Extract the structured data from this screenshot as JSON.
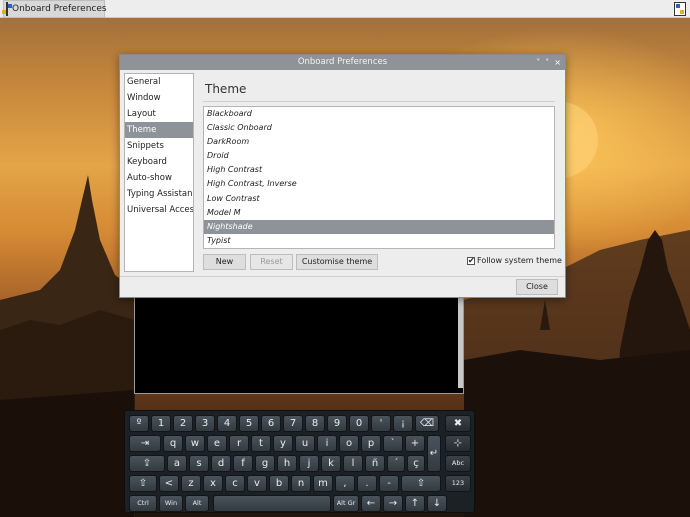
{
  "taskbar": {
    "app_label": "Onboard Preferences",
    "app_icon": "onboard-app-icon",
    "tray_icon": "onboard-tray-icon"
  },
  "dialog": {
    "title": "Onboard Preferences",
    "controls": [
      "˅",
      "˄",
      "×"
    ],
    "sidebar": {
      "items": [
        "General",
        "Window",
        "Layout",
        "Theme",
        "Snippets",
        "Keyboard",
        "Auto-show",
        "Typing Assistance",
        "Universal Access"
      ],
      "selected": "Theme"
    },
    "section_title": "Theme",
    "themes": [
      "Blackboard",
      "Classic Onboard",
      "DarkRoom",
      "Droid",
      "High Contrast",
      "High Contrast, Inverse",
      "Low Contrast",
      "Model M",
      "Nightshade",
      "Typist"
    ],
    "selected_theme": "Nightshade",
    "buttons": {
      "new": "New",
      "reset": "Reset",
      "customise": "Customise theme",
      "close": "Close"
    },
    "follow_system_theme": {
      "label": "Follow system theme",
      "checked": true,
      "mark": "✔"
    }
  },
  "keyboard": {
    "row1": [
      "º",
      "1",
      "2",
      "3",
      "4",
      "5",
      "6",
      "7",
      "8",
      "9",
      "0",
      "'",
      "¡",
      "⌫",
      "✖"
    ],
    "row2": [
      "⇥",
      "q",
      "w",
      "e",
      "r",
      "t",
      "y",
      "u",
      "i",
      "o",
      "p",
      "`",
      "+",
      "↵",
      "⊹"
    ],
    "row3": [
      "⇪",
      "a",
      "s",
      "d",
      "f",
      "g",
      "h",
      "j",
      "k",
      "l",
      "ñ",
      "´",
      "ç",
      "Abc"
    ],
    "row4": [
      "⇧",
      "<",
      "z",
      "x",
      "c",
      "v",
      "b",
      "n",
      "m",
      ",",
      ".",
      "-",
      "⇧",
      "123"
    ],
    "row5": [
      "Ctrl",
      "Win",
      "Alt",
      "",
      "Alt Gr",
      "←",
      "→",
      "↑",
      "↓"
    ]
  }
}
